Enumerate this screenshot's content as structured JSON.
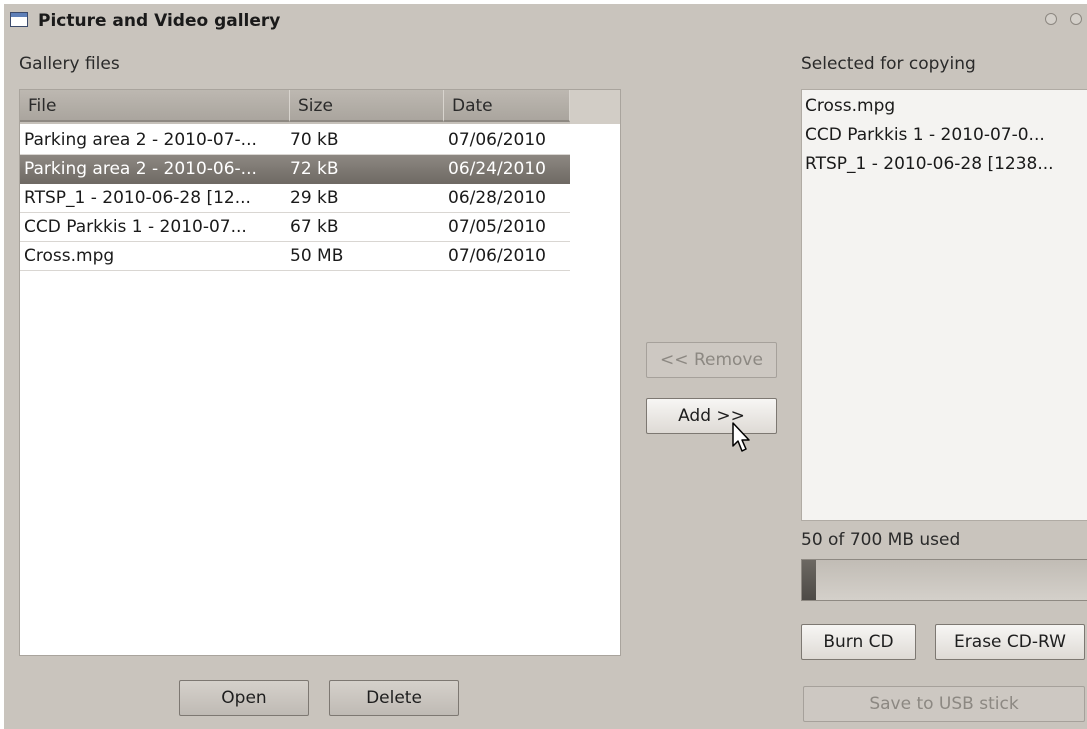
{
  "window": {
    "title": "Picture and Video gallery"
  },
  "gallery": {
    "label": "Gallery files",
    "columns": [
      "File",
      "Size",
      "Date"
    ],
    "rows": [
      {
        "file": "Parking area 2 - 2010-07-...",
        "size": "70 kB",
        "date": "07/06/2010"
      },
      {
        "file": "Parking area 2 - 2010-06-...",
        "size": "72 kB",
        "date": "06/24/2010"
      },
      {
        "file": "RTSP_1 - 2010-06-28 [12...",
        "size": "29 kB",
        "date": "06/28/2010"
      },
      {
        "file": "CCD Parkkis 1 - 2010-07...",
        "size": "67 kB",
        "date": "07/05/2010"
      },
      {
        "file": "Cross.mpg",
        "size": "50 MB",
        "date": "07/06/2010"
      }
    ],
    "selected_row": 1,
    "open_label": "Open",
    "delete_label": "Delete"
  },
  "transfer": {
    "remove_label": "<< Remove",
    "add_label": "Add >>"
  },
  "selection": {
    "label": "Selected for copying",
    "items": [
      "Cross.mpg",
      "CCD Parkkis 1 - 2010-07-0...",
      "RTSP_1 - 2010-06-28 [1238..."
    ]
  },
  "usage": {
    "text": "50 of 700 MB used",
    "used_mb": 50,
    "capacity_mb": 700
  },
  "actions": {
    "burn_label": "Burn CD",
    "erase_label": "Erase CD-RW",
    "usb_label": "Save to USB stick"
  },
  "icons": {
    "window": "window-icon",
    "cursor": "mouse-pointer-icon"
  }
}
